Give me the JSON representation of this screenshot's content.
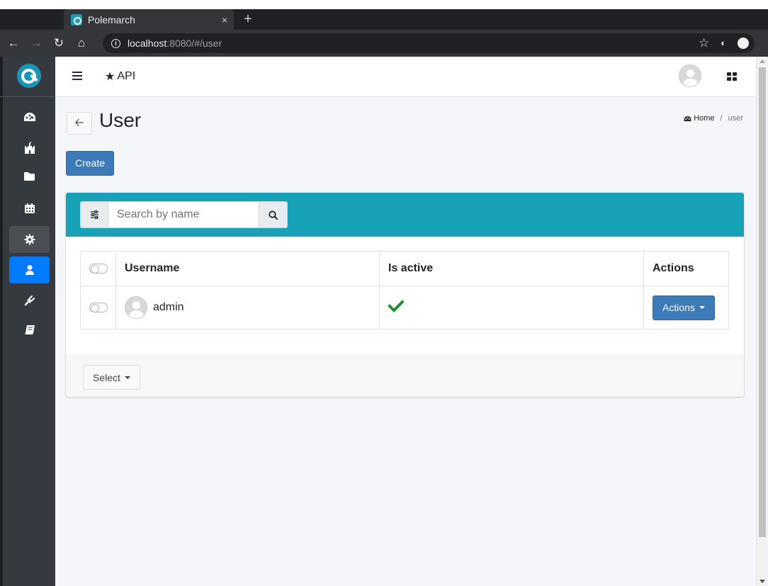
{
  "browser": {
    "tab_title": "Polemarch",
    "tab_close": "×",
    "new_tab": "+",
    "url_host": "localhost",
    "url_rest": ":8080/#/user"
  },
  "header": {
    "api_label": "API"
  },
  "page": {
    "title": "User",
    "breadcrumb_home": "Home",
    "breadcrumb_sep": "/",
    "breadcrumb_current": "user",
    "create_label": "Create"
  },
  "search": {
    "placeholder": "Search by name"
  },
  "table": {
    "columns": [
      "Username",
      "Is active",
      "Actions"
    ],
    "rows": [
      {
        "username": "admin",
        "is_active": true,
        "actions_label": "Actions"
      }
    ]
  },
  "footer": {
    "select_label": "Select"
  },
  "sidebar": {
    "items": [
      {
        "icon": "dashboard-icon"
      },
      {
        "icon": "projects-icon"
      },
      {
        "icon": "folder-icon"
      },
      {
        "icon": "calendar-icon"
      },
      {
        "icon": "gear-icon",
        "state": "open"
      },
      {
        "icon": "user-icon",
        "state": "active"
      },
      {
        "icon": "plug-icon"
      },
      {
        "icon": "book-icon"
      }
    ]
  },
  "colors": {
    "sidebar_bg": "#343a40",
    "active_nav": "#007bff",
    "card_header": "#17a2b8",
    "primary_button": "#3c7ab8",
    "check_green": "#28a745"
  }
}
